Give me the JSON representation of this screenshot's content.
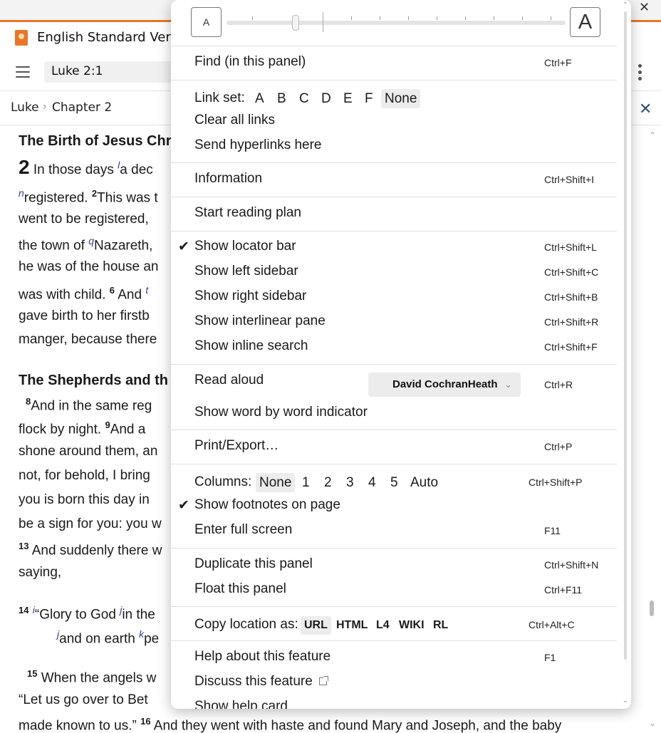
{
  "window": {
    "tab_title": "English Standard Version",
    "close_glyph": "✕"
  },
  "toolbar": {
    "reference": "Luke 2:1"
  },
  "breadcrumb": {
    "book": "Luke",
    "sep": "›",
    "chapter": "Chapter 2"
  },
  "text": {
    "heading1": "The Birth of Jesus Chr",
    "chapter": "2",
    "l1": " In those days ",
    "l1_fn": "l",
    "l1_tail": "a dec",
    "l2_fn": "n",
    "l2": "registered. ",
    "l2_v": "2",
    "l2_tail": "This was t",
    "l3": "went to be registered, ",
    "l4": "the town of ",
    "l4_fn": "q",
    "l4_tail": "Nazareth,",
    "l5": "he was of the house an",
    "l6": "was with child. ",
    "l6_v": "6",
    "l6_tail": " And ",
    "l6_fn": "t",
    "l7": "gave birth to her firstb",
    "l8": "manger, because there",
    "heading2": "The Shepherds and th",
    "l9_v": "8",
    "l9": "And in the same reg",
    "l10": "flock by night. ",
    "l10_v": "9",
    "l10_tail": "And a",
    "l11": "shone around them, an",
    "l12": "not, for behold, I bring",
    "l13": "you is born this day in",
    "l14": "be a sign for you: you w",
    "l15_v": "13",
    "l15": " And suddenly there w",
    "l16": "saying,",
    "l17_v": "14",
    "l17_fn": "i",
    "l17": "“Glory to God ",
    "l17_fn2": "j",
    "l17_tail": "in the",
    "l18_fn": "j",
    "l18": "and on earth ",
    "l18_fn2": "k",
    "l18_tail": "pe",
    "l19_v": "15",
    "l19": " When the angels w",
    "l20": "“Let us go over to Bet",
    "l21": "made known to us.” ",
    "l21_v": "16",
    "l21_tail": " And they went with haste and found Mary and Joseph, and the baby"
  },
  "menu": {
    "font_small": "A",
    "font_large": "A",
    "find": {
      "label": "Find (in this panel)",
      "shortcut": "Ctrl+F"
    },
    "link_set": {
      "label": "Link set:",
      "options": [
        "A",
        "B",
        "C",
        "D",
        "E",
        "F",
        "None"
      ],
      "selected": "None"
    },
    "clear_links": "Clear all links",
    "send_hyperlinks": "Send hyperlinks here",
    "information": {
      "label": "Information",
      "shortcut": "Ctrl+Shift+I"
    },
    "reading_plan": "Start reading plan",
    "check_glyph": "✔",
    "locator_bar": {
      "label": "Show locator bar",
      "shortcut": "Ctrl+Shift+L",
      "checked": true
    },
    "left_sidebar": {
      "label": "Show left sidebar",
      "shortcut": "Ctrl+Shift+C"
    },
    "right_sidebar": {
      "label": "Show right sidebar",
      "shortcut": "Ctrl+Shift+B"
    },
    "interlinear": {
      "label": "Show interlinear pane",
      "shortcut": "Ctrl+Shift+R"
    },
    "inline_search": {
      "label": "Show inline search",
      "shortcut": "Ctrl+Shift+F"
    },
    "read_aloud": {
      "label": "Read aloud",
      "voice": "David CochranHeath",
      "voice_chevron": "⌄",
      "shortcut": "Ctrl+R"
    },
    "word_indicator": "Show word by word indicator",
    "print": {
      "label": "Print/Export…",
      "shortcut": "Ctrl+P"
    },
    "columns": {
      "label": "Columns:",
      "options": [
        "None",
        "1",
        "2",
        "3",
        "4",
        "5",
        "Auto"
      ],
      "selected": "None",
      "shortcut": "Ctrl+Shift+P"
    },
    "footnotes": {
      "label": "Show footnotes on page",
      "checked": true
    },
    "fullscreen": {
      "label": "Enter full screen",
      "shortcut": "F11"
    },
    "duplicate": {
      "label": "Duplicate this panel",
      "shortcut": "Ctrl+Shift+N"
    },
    "float": {
      "label": "Float this panel",
      "shortcut": "Ctrl+F11"
    },
    "copy_location": {
      "label": "Copy location as:",
      "options": [
        "URL",
        "HTML",
        "L4",
        "WIKI",
        "RL"
      ],
      "selected": "URL",
      "shortcut": "Ctrl+Alt+C"
    },
    "help": {
      "label": "Help about this feature",
      "shortcut": "F1"
    },
    "discuss": "Discuss this feature",
    "help_card": "Show help card"
  }
}
